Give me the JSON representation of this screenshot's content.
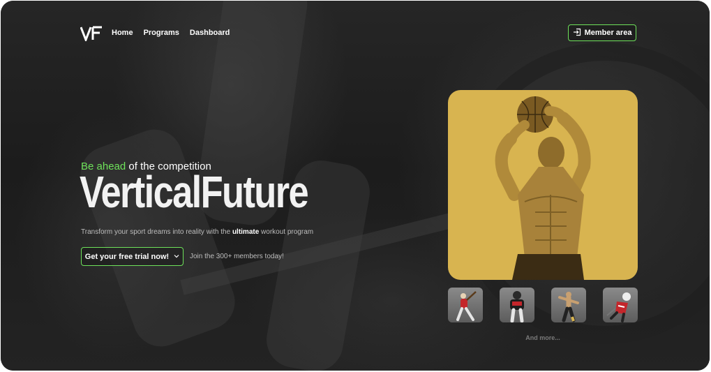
{
  "nav": {
    "links": [
      {
        "label": "Home"
      },
      {
        "label": "Programs"
      },
      {
        "label": "Dashboard"
      }
    ],
    "member_label": "Member area"
  },
  "hero": {
    "tagline_accent": "Be ahead",
    "tagline_rest": " of the competition",
    "title": "VerticalFuture",
    "subtitle_before": "Transform your sport dreams into reality with the ",
    "subtitle_bold": "ultimate",
    "subtitle_after": " workout program",
    "cta_label": "Get your free trial now!",
    "join_text": "Join the 300+ members today!"
  },
  "gallery": {
    "more_label": "And more..."
  },
  "colors": {
    "accent": "#6ee25a",
    "feature_bg": "#d8b450",
    "page_bg": "#1f1f1f"
  }
}
